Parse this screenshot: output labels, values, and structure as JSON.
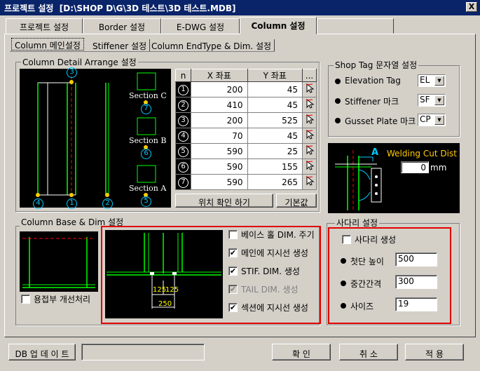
{
  "window": {
    "title": "프로젝트 설정  [D:\\SHOP D\\G\\3D 테스트\\3D 테스트.MDB]",
    "close": "X"
  },
  "tabs": [
    "프로젝트 설정",
    "Border 설정",
    "E-DWG 설정",
    "Column 설정",
    ""
  ],
  "subtabs": [
    "Column 메인설정",
    "Stiffener 설정",
    "Column EndType & Dim. 설정"
  ],
  "arrange": {
    "label": "Column Detail Arrange 설정",
    "sections": [
      "Section C",
      "Section B",
      "Section A"
    ],
    "markers": {
      "top": "3",
      "bottom": [
        "4",
        "1",
        "2",
        "5"
      ],
      "c": "7",
      "b": "6"
    },
    "table": {
      "headers": [
        "n",
        "X 좌표",
        "Y 좌표",
        "..."
      ],
      "rows": [
        {
          "n": "1",
          "x": "200",
          "y": "45"
        },
        {
          "n": "2",
          "x": "410",
          "y": "45"
        },
        {
          "n": "3",
          "x": "200",
          "y": "525"
        },
        {
          "n": "4",
          "x": "70",
          "y": "45"
        },
        {
          "n": "5",
          "x": "590",
          "y": "25"
        },
        {
          "n": "6",
          "x": "590",
          "y": "155"
        },
        {
          "n": "7",
          "x": "590",
          "y": "265"
        }
      ]
    },
    "check_button": "위치 확인 하기",
    "default_button": "기본값"
  },
  "shoptag": {
    "label": "Shop Tag 문자열 설정",
    "items": [
      {
        "label": "Elevation Tag",
        "value": "EL"
      },
      {
        "label": "Stiffener 마크",
        "value": "SF"
      },
      {
        "label": "Gusset Plate 마크",
        "value": "CP"
      }
    ]
  },
  "welding": {
    "label": "Welding Cut Dist",
    "value": "0",
    "unit": "mm",
    "marker": "A"
  },
  "base": {
    "label": "Column Base & Dim 설정",
    "weld_check": "용접부 개선처리",
    "dims": [
      "125",
      "125",
      "250"
    ],
    "options": [
      {
        "label": "베이스 홀 DIM. 주기",
        "checked": false,
        "disabled": false
      },
      {
        "label": "메인에 지시선 생성",
        "checked": true,
        "disabled": false
      },
      {
        "label": "STIF. DIM. 생성",
        "checked": true,
        "disabled": false
      },
      {
        "label": "TAIL DIM. 생성",
        "checked": true,
        "disabled": true
      },
      {
        "label": "섹션에 지시선 생성",
        "checked": true,
        "disabled": false
      }
    ]
  },
  "ladder": {
    "label": "사다리 설정",
    "create": "사다리 생성",
    "fields": [
      {
        "label": "첫단 높이",
        "value": "500"
      },
      {
        "label": "중간간격",
        "value": "300"
      },
      {
        "label": "사이즈",
        "value": "19"
      }
    ]
  },
  "footer": {
    "db_update": "DB 업 데 이 트",
    "status": "",
    "ok": "확  인",
    "cancel": "취  소",
    "apply": "적  용"
  }
}
